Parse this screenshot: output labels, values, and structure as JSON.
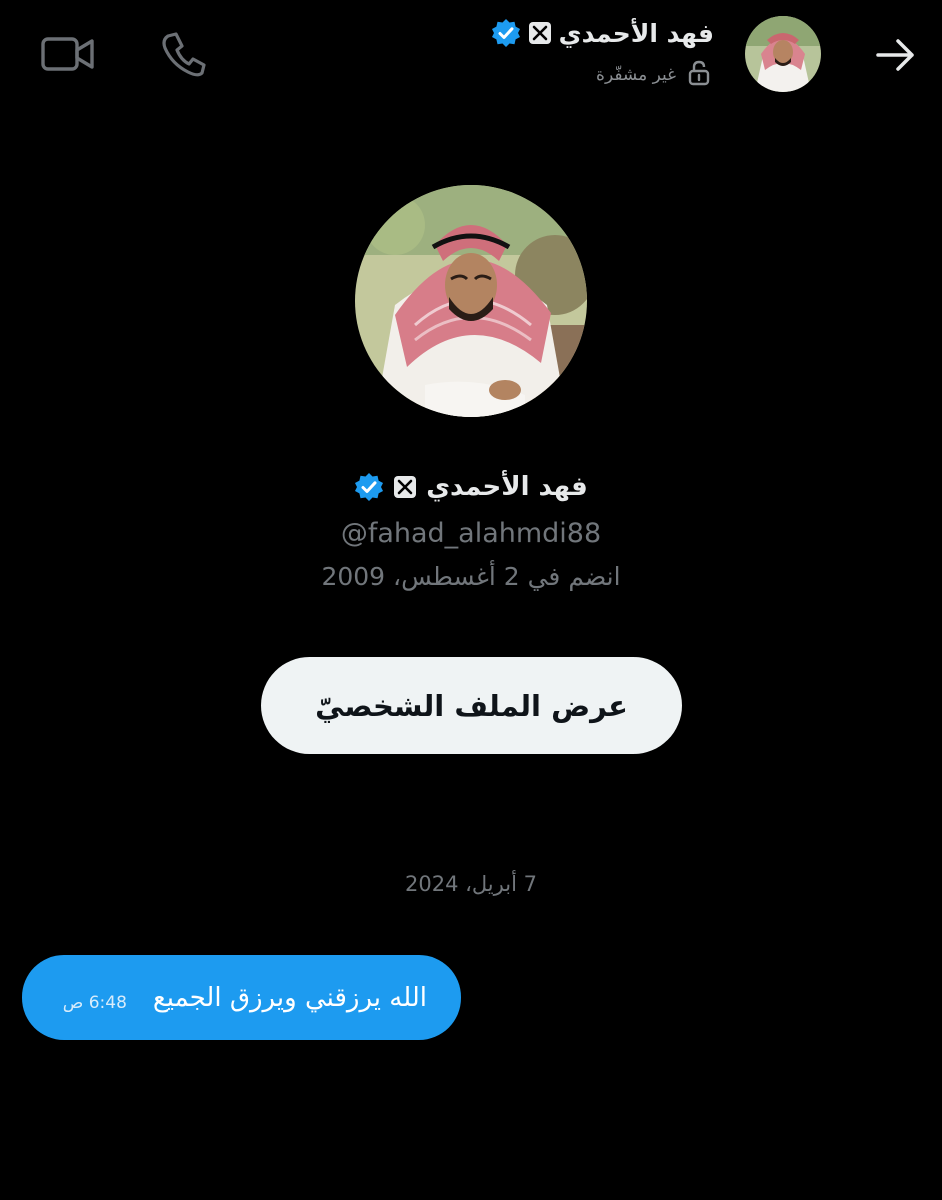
{
  "header": {
    "name": "فهد الأحمدي",
    "encryption_status": "غير مشفّرة",
    "icons": [
      "back-arrow-icon",
      "avatar",
      "x-badge-icon",
      "verified-icon",
      "unlock-icon",
      "video-call-icon",
      "phone-icon"
    ]
  },
  "profile": {
    "name": "فهد الأحمدي",
    "handle": "@fahad_alahmdi88",
    "joined": "انضم في 2 أغسطس، 2009",
    "view_profile_label": "عرض الملف الشخصيّ"
  },
  "conversation": {
    "date_separator": "7 أبريل، 2024",
    "messages": [
      {
        "text": "الله يرزقني ويرزق الجميع",
        "time": "6:48 ص"
      }
    ]
  },
  "colors": {
    "background": "#000000",
    "accent": "#1d9bf0",
    "verified": "#1d9bf0",
    "secondary_text": "#71767b",
    "button_bg": "#eff3f4"
  }
}
